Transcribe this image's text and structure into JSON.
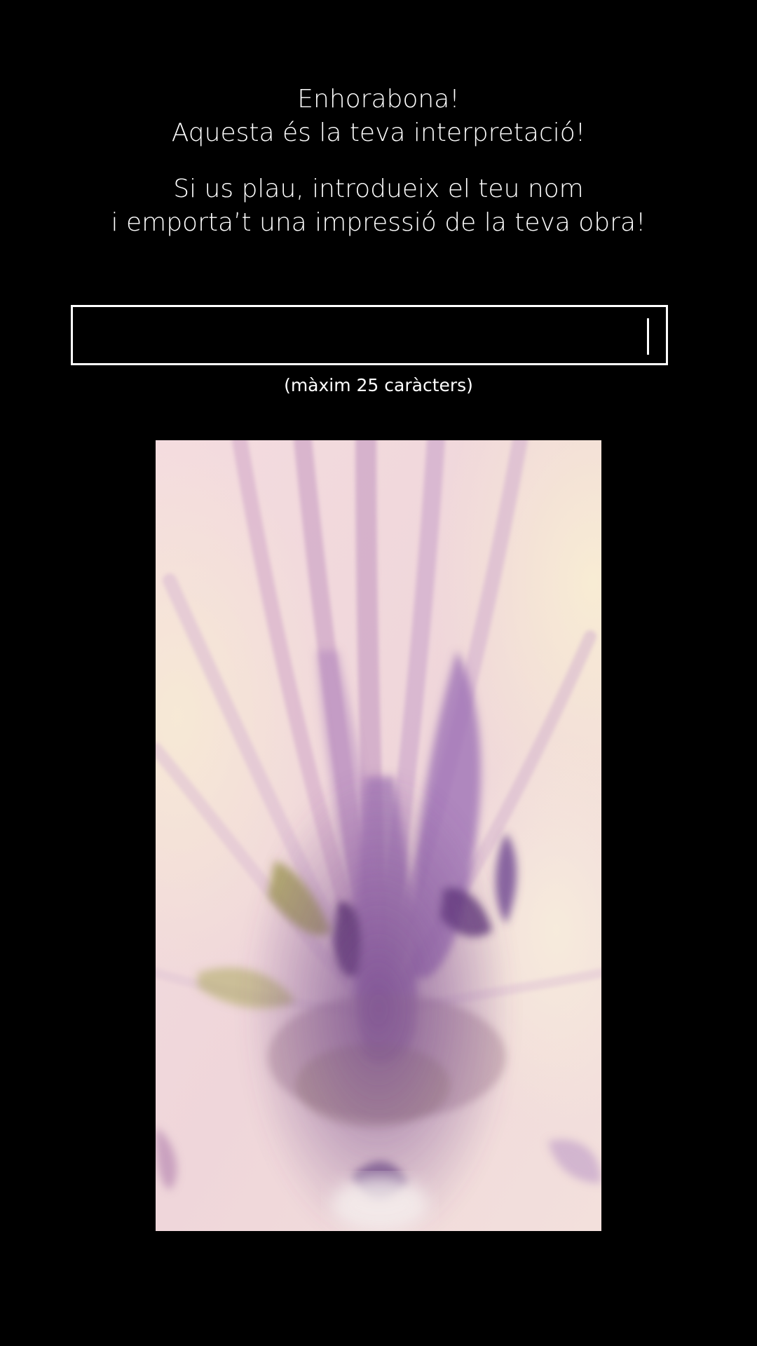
{
  "header": {
    "line1": "Enhorabona!",
    "line2": "Aquesta és la teva interpretació!"
  },
  "prompt": {
    "line1": "Si us plau, introdueix el teu nom",
    "line2": "i emporta’t una impressió de la teva obra!"
  },
  "name_input": {
    "value": "",
    "placeholder": "",
    "hint": "(màxim 25 caràcters)",
    "max_length": 25
  },
  "artwork": {
    "description_icon": "abstract-floral-artwork",
    "colors": {
      "background": "#f3dfe0",
      "cream": "#f6e9d6",
      "lilac": "#c9a3c9",
      "purple": "#7e4f99",
      "deep_purple": "#4e2a63",
      "olive": "#a7a25a"
    }
  },
  "theme": {
    "background": "#000000",
    "text": "#ffffff"
  }
}
